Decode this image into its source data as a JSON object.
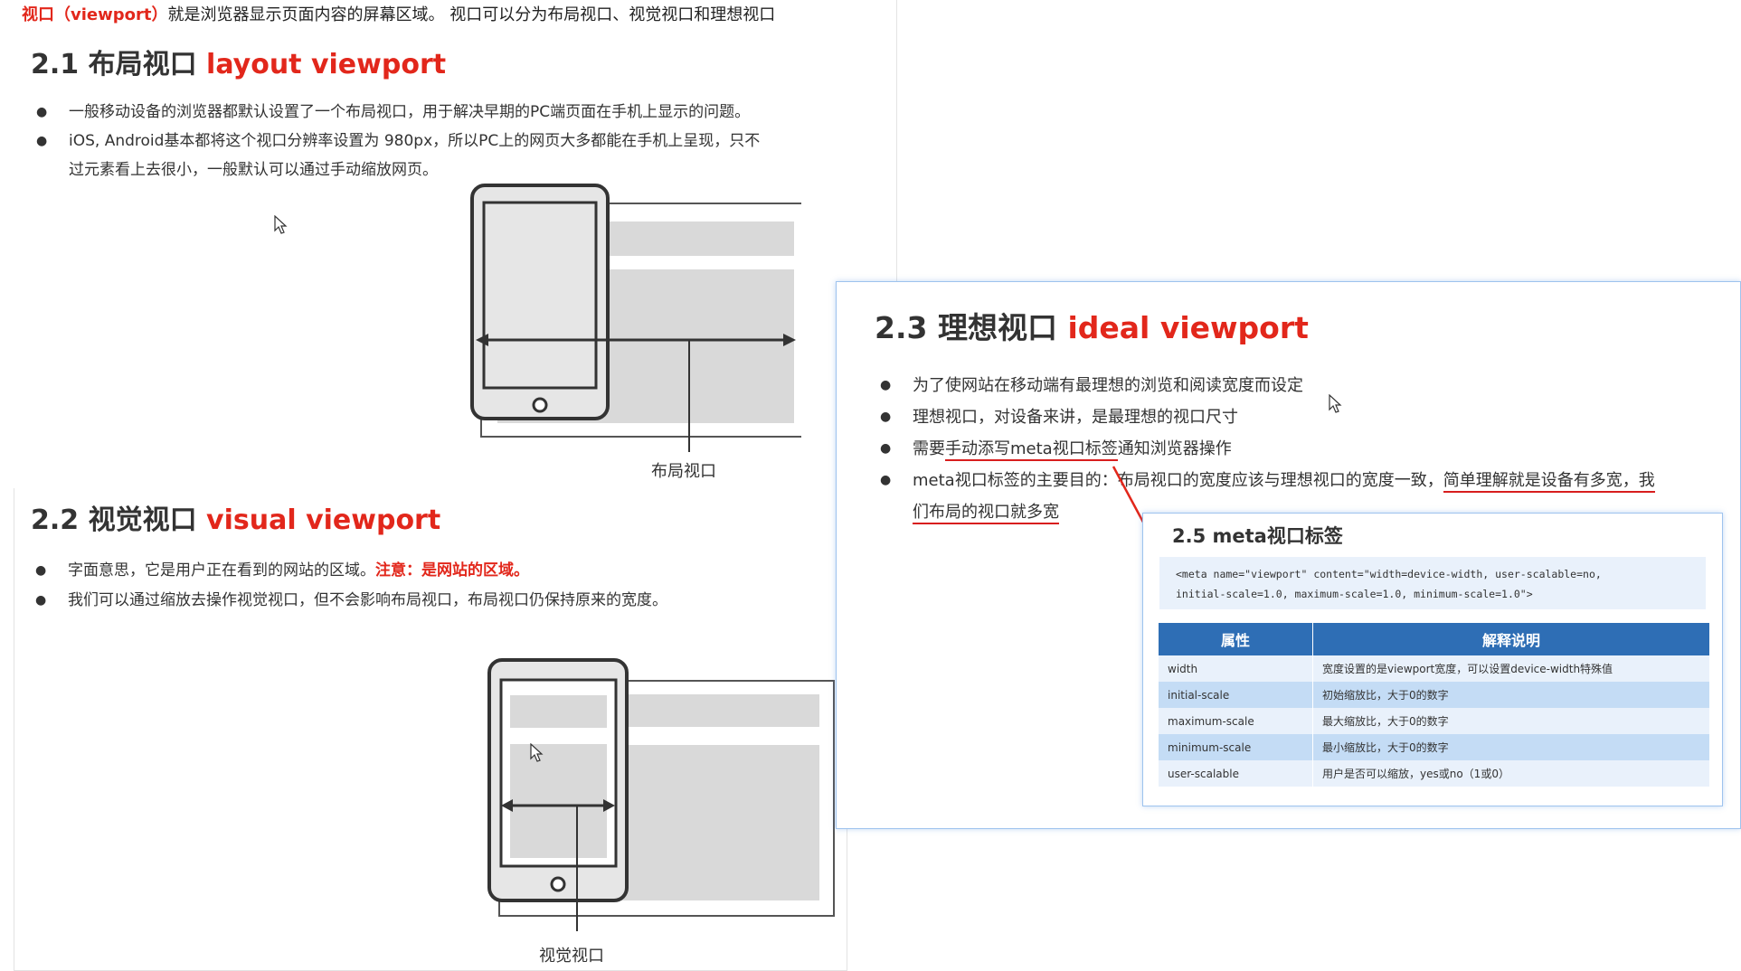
{
  "intro": {
    "term": "视口（viewport）",
    "text": "就是浏览器显示页面内容的屏幕区域。 视口可以分为布局视口、视觉视口和理想视口"
  },
  "sec21": {
    "num": "2.1 布局视口",
    "en": "layout viewport",
    "bullets": [
      "一般移动设备的浏览器都默认设置了一个布局视口，用于解决早期的PC端页面在手机上显示的问题。",
      "iOS, Android基本都将这个视口分辨率设置为 980px，所以PC上的网页大多都能在手机上呈现，只不",
      "过元素看上去很小，一般默认可以通过手动缩放网页。"
    ],
    "diagram_label": "布局视口"
  },
  "sec22": {
    "num": "2.2 视觉视口",
    "en": "visual viewport",
    "bullet1_text": "字面意思，它是用户正在看到的网站的区域。",
    "bullet1_note": "注意：是网站的区域。",
    "bullet2": "我们可以通过缩放去操作视觉视口，但不会影响布局视口，布局视口仍保持原来的宽度。",
    "diagram_label": "视觉视口"
  },
  "sec23": {
    "num": "2.3 理想视口",
    "en": "ideal viewport",
    "b1": "为了使网站在移动端有最理想的浏览和阅读宽度而设定",
    "b2": "理想视口，对设备来讲，是最理想的视口尺寸",
    "b3_pre": "需要",
    "b3_ul": "手动添写meta视口标签",
    "b3_post": "通知浏览器操作",
    "b4_pre": "meta视口标签的主要目的：布局视口的宽度应该与理想视口的宽度一致，",
    "b4_ul": "简单理解就是设备有多宽，我",
    "b4_line2": "们布局的视口就多宽"
  },
  "sec25": {
    "title": "2.5 meta视口标签",
    "code_line1": "<meta name=\"viewport\" content=\"width=device-width, user-scalable=no,",
    "code_line2": "initial-scale=1.0, maximum-scale=1.0, minimum-scale=1.0\">",
    "headers": [
      "属性",
      "解释说明"
    ],
    "rows": [
      [
        "width",
        "宽度设置的是viewport宽度，可以设置device-width特殊值"
      ],
      [
        "initial-scale",
        "初始缩放比，大于0的数字"
      ],
      [
        "maximum-scale",
        "最大缩放比，大于0的数字"
      ],
      [
        "minimum-scale",
        "最小缩放比，大于0的数字"
      ],
      [
        "user-scalable",
        "用户是否可以缩放，yes或no（1或0）"
      ]
    ]
  },
  "colors": {
    "accent_red": "#e2271b",
    "table_header": "#2e6eb5",
    "row_light": "#e9f1fb",
    "row_blue": "#c4dcf5"
  }
}
